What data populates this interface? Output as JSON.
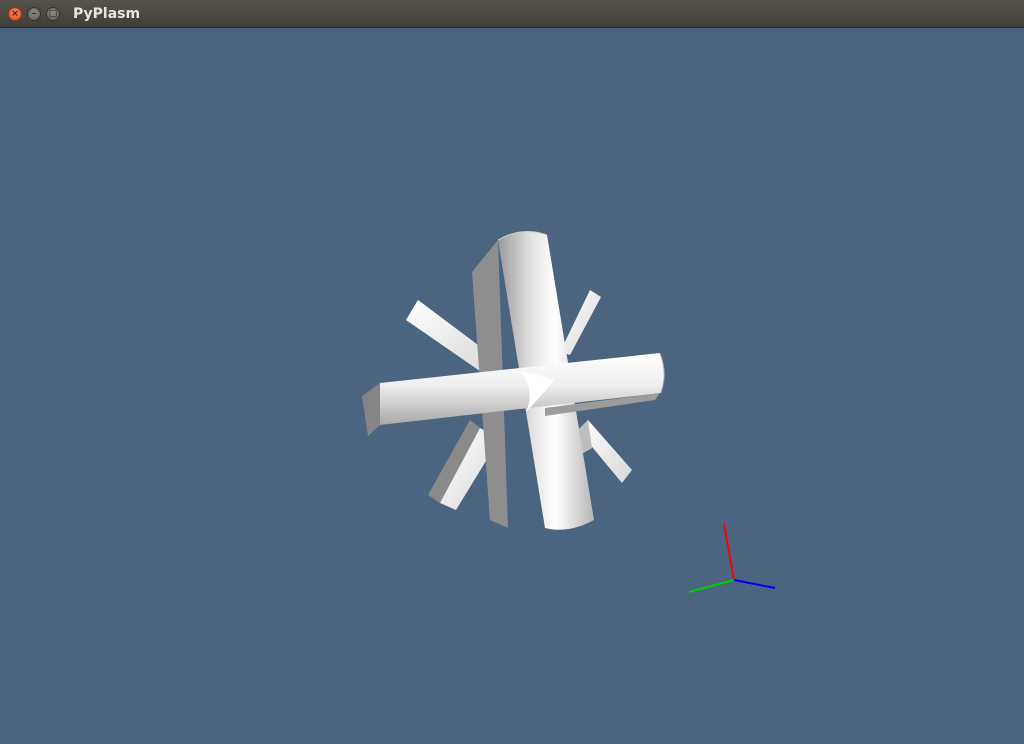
{
  "window": {
    "title": "PyPlasm",
    "buttons": {
      "close_icon": "close-icon",
      "minimize_icon": "minimize-icon",
      "maximize_icon": "maximize-icon"
    }
  },
  "viewport": {
    "background_color": "#4b6581",
    "model_color": "#e6e6e6",
    "axes": {
      "x_color": "#ff0000",
      "y_color": "#00cc00",
      "z_color": "#0000ff"
    }
  }
}
